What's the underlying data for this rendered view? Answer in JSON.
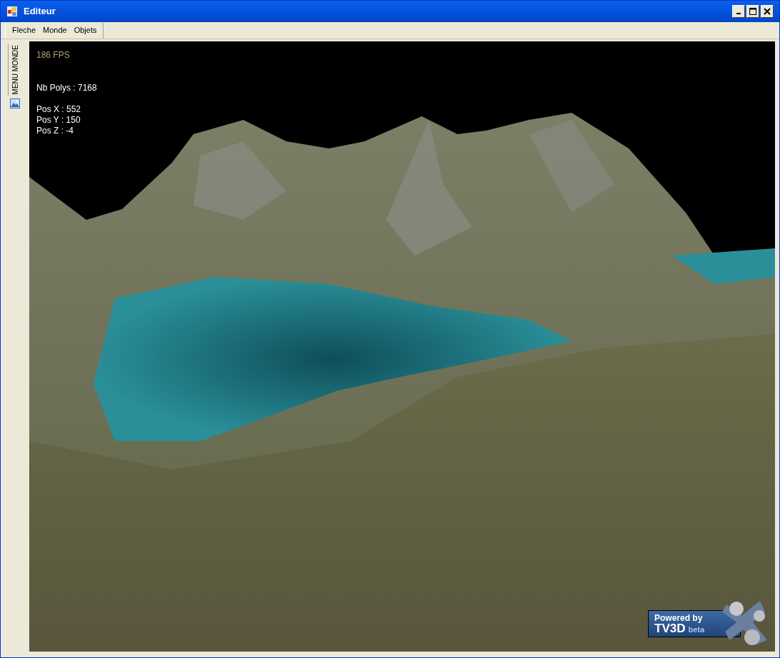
{
  "window": {
    "title": "Editeur"
  },
  "menu": [
    "Fleche",
    "Monde",
    "Objets"
  ],
  "sidebar": {
    "tab_label": "MENU MONDE"
  },
  "viewport": {
    "fps": "186 FPS",
    "stats": [
      "Nb Polys : 7168"
    ],
    "position": [
      "Pos X : 552",
      "Pos Y : 150",
      "Pos Z : -4"
    ],
    "logo": {
      "line_1": "Powered by",
      "brand": "TV3D",
      "tag": "beta"
    }
  }
}
